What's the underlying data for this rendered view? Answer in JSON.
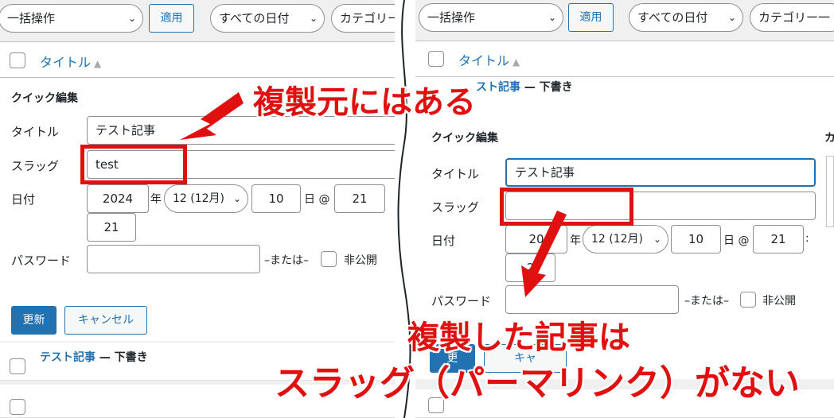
{
  "left": {
    "toolbar": {
      "bulk_action": "一括操作",
      "apply": "適用",
      "dates": "すべての日付",
      "category": "カテゴリー"
    },
    "table_header": {
      "title_col": "タイトル"
    },
    "quick_edit": {
      "heading": "クイック編集",
      "title_label": "タイトル",
      "title_value": "テスト記事",
      "slug_label": "スラッグ",
      "slug_value": "test",
      "date_label": "日付",
      "year": "2024",
      "year_suffix": "年",
      "month": "12 (12月)",
      "day": "10",
      "day_suffix": "日 @",
      "hour": "21",
      "minute": "21",
      "password_label": "パスワード",
      "or": "–または–",
      "private": "非公開",
      "update": "更新",
      "cancel": "キャンセル"
    },
    "row": {
      "title": "テスト記事",
      "status": "— 下書き"
    }
  },
  "right": {
    "toolbar": {
      "bulk_action": "一括操作",
      "apply": "適用",
      "dates": "すべての日付",
      "category": "カテゴリー一"
    },
    "table_header": {
      "title_col": "タイトル"
    },
    "row_above": {
      "title": "スト記事",
      "status": "— 下書き"
    },
    "quick_edit": {
      "heading": "クイック編集",
      "side_heading": "カ",
      "title_label": "タイトル",
      "title_value": "テスト記事",
      "slug_label": "スラッグ",
      "slug_value": "",
      "date_label": "日付",
      "year": "20",
      "year_suffix": "年",
      "month": "12 (12月)",
      "day": "10",
      "day_suffix": "日 @",
      "hour": "21",
      "minute_sep": ":",
      "minute": "2",
      "password_label": "パスワード",
      "or": "–または–",
      "private": "非公開",
      "update": "更",
      "cancel": "キャ"
    }
  },
  "annotations": {
    "top": "複製元にはある",
    "bottom_line1": "複製した記事は",
    "bottom_line2": "スラッグ（パーマリンク）がない",
    "color": "#e01010"
  },
  "ui_colors": {
    "accent": "#2271b1",
    "background": "#f0f0f1"
  },
  "icons": [
    "chevron-down-icon",
    "sort-icon",
    "checkbox",
    "arrow-icon"
  ]
}
